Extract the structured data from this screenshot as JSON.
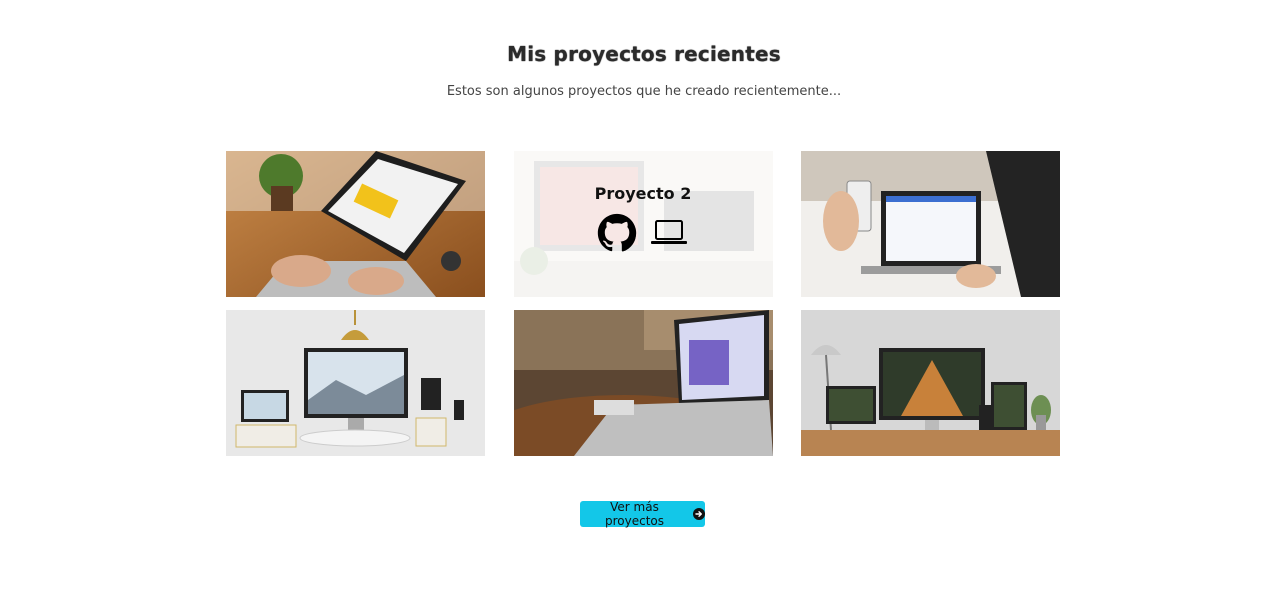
{
  "section": {
    "title": "Mis proyectos recientes",
    "subtitle": "Estos son algunos proyectos que he creado recientemente..."
  },
  "projects": [
    {
      "image": "laptop-on-wooden-desk"
    },
    {
      "image": "computer-desk-workspace",
      "overlay_title": "Proyecto 2",
      "icons": [
        "github-icon",
        "laptop-icon"
      ]
    },
    {
      "image": "phone-and-laptop-in-hands"
    },
    {
      "image": "responsive-devices-on-pedestals"
    },
    {
      "image": "laptop-on-round-table"
    },
    {
      "image": "responsive-devices-on-desk"
    }
  ],
  "more_button": {
    "label": "Ver más proyectos",
    "icon": "arrow-circle-right-icon"
  },
  "colors": {
    "accent": "#13c7e8",
    "text": "#2b2b2b",
    "subtext": "#444444"
  }
}
